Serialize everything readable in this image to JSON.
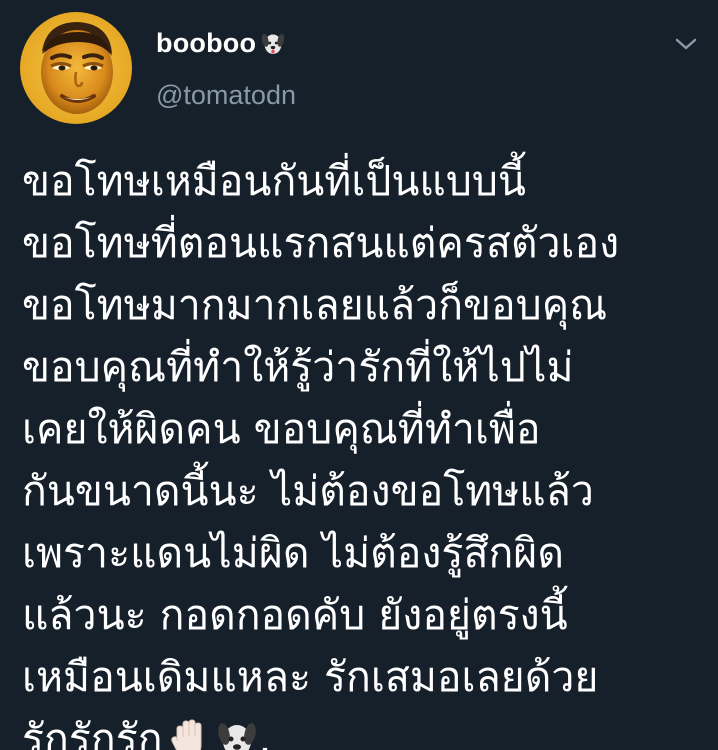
{
  "user": {
    "display_name": "booboo",
    "handle": "@tomatodn",
    "name_emoji": "dog-face-icon"
  },
  "tweet": {
    "lines": [
      "ขอโทษเหมือนกันที่เป็นแบบนี้",
      "ขอโทษที่ตอนแรกสนแต่ครสตัวเอง",
      "ขอโทษมากมากเลยแล้วก็ขอบคุณ",
      "ขอบคุณที่ทำให้รู้ว่ารักที่ให้ไปไม่",
      "เคยให้ผิดคน ขอบคุณที่ทำเพื่อ",
      "กันขนาดนี้นะ ไม่ต้องขอโทษแล้ว",
      "เพราะแดนไม่ผิด ไม่ต้องรู้สึกผิด",
      "แล้วนะ กอดกอดคับ ยังอยู่ตรงนี้",
      "เหมือนเดิมแหละ รักเสมอเลยด้วย"
    ],
    "last_line_text": "รักรักรัก",
    "last_line_suffix": ".",
    "last_line_emojis": [
      "raised-hand-icon",
      "dog-face-icon"
    ]
  },
  "colors": {
    "background": "#15202b",
    "text": "#ffffff",
    "secondary_text": "#8899a6"
  }
}
